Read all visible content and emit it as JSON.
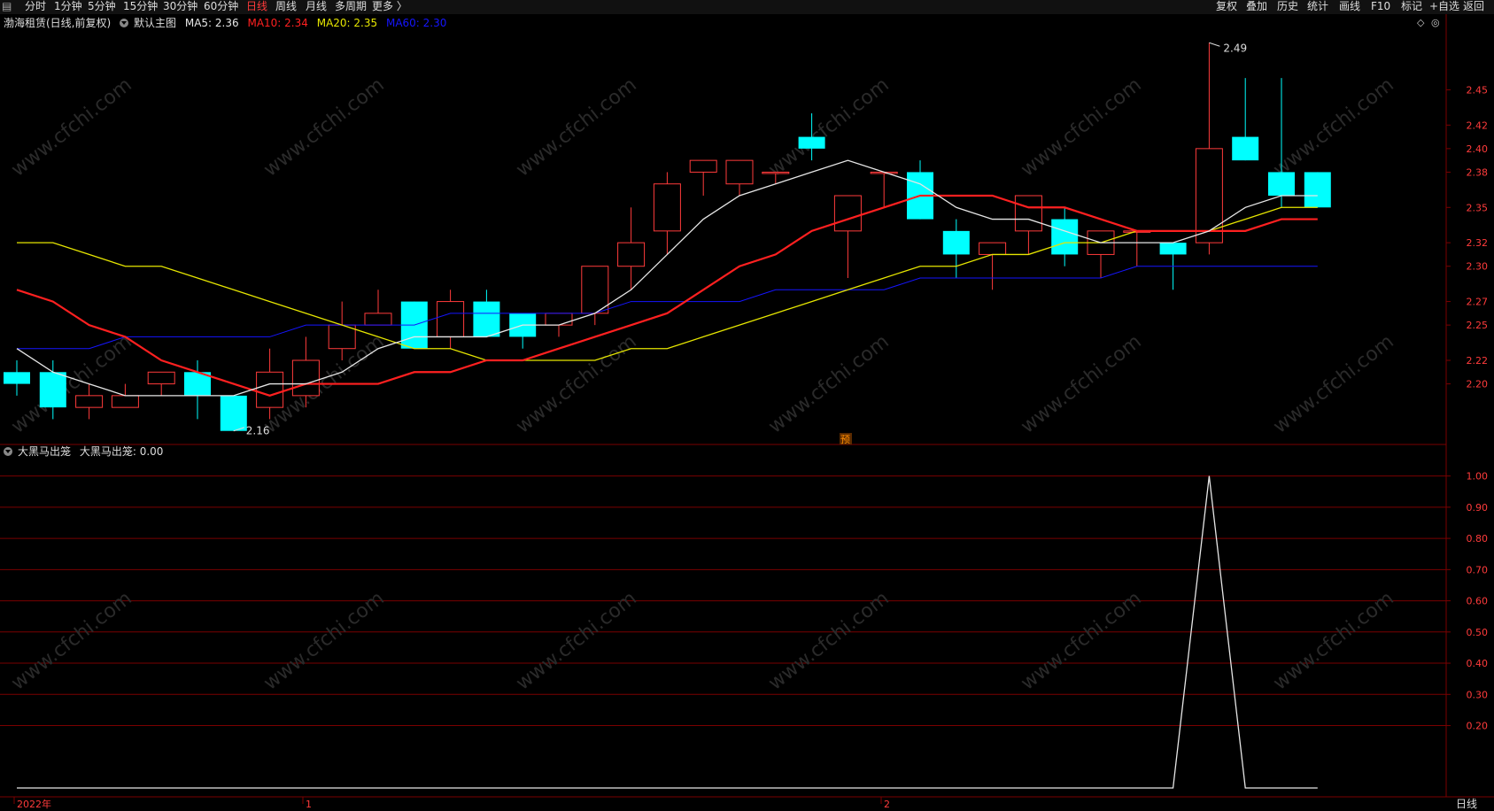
{
  "toolbar": {
    "left_items": [
      "分时",
      "1分钟",
      "5分钟",
      "15分钟",
      "30分钟",
      "60分钟",
      "日线",
      "周线",
      "月线",
      "多周期",
      "更多 〉"
    ],
    "active_item": "日线",
    "right_items": [
      "复权",
      "叠加",
      "历史",
      "统计",
      "画线",
      "F10",
      "标记",
      "+自选",
      "返回"
    ]
  },
  "main_header": {
    "stock_name": "渤海租赁(日线,前复权)",
    "chart_name": "默认主图",
    "ma5": "MA5: 2.36",
    "ma10": "MA10: 2.34",
    "ma20": "MA20: 2.35",
    "ma60": "MA60: 2.30"
  },
  "sub_header": {
    "indicator": "大黑马出笼",
    "value_text": "大黑马出笼: 0.00"
  },
  "colors": {
    "up": "#ff3b3b",
    "down": "#00ffff",
    "ma5": "#e6e6e6",
    "ma10": "#ff2020",
    "ma20": "#e6e600",
    "ma60": "#1515ff",
    "grid": "#7a0000",
    "axis_text": "#ff3b3b"
  },
  "annotations": {
    "high_label": "2.49",
    "low_label": "2.16",
    "marker": "预"
  },
  "x_axis": {
    "labels": [
      "2022年",
      "1",
      "2"
    ],
    "period_label": "日线"
  },
  "watermark": "www.cfchi.com",
  "chart_data": [
    {
      "type": "candlestick",
      "y_ticks": [
        2.2,
        2.22,
        2.25,
        2.27,
        2.3,
        2.32,
        2.35,
        2.38,
        2.4,
        2.42,
        2.45
      ],
      "ylim": [
        2.15,
        2.5
      ],
      "candles": [
        {
          "o": 2.21,
          "c": 2.2,
          "h": 2.22,
          "l": 2.19
        },
        {
          "o": 2.21,
          "c": 2.18,
          "h": 2.22,
          "l": 2.17
        },
        {
          "o": 2.18,
          "c": 2.19,
          "h": 2.2,
          "l": 2.17
        },
        {
          "o": 2.18,
          "c": 2.19,
          "h": 2.2,
          "l": 2.18
        },
        {
          "o": 2.2,
          "c": 2.21,
          "h": 2.21,
          "l": 2.19
        },
        {
          "o": 2.21,
          "c": 2.19,
          "h": 2.22,
          "l": 2.17
        },
        {
          "o": 2.19,
          "c": 2.16,
          "h": 2.19,
          "l": 2.16
        },
        {
          "o": 2.18,
          "c": 2.21,
          "h": 2.23,
          "l": 2.17
        },
        {
          "o": 2.19,
          "c": 2.22,
          "h": 2.24,
          "l": 2.18
        },
        {
          "o": 2.23,
          "c": 2.25,
          "h": 2.27,
          "l": 2.22
        },
        {
          "o": 2.25,
          "c": 2.26,
          "h": 2.28,
          "l": 2.25
        },
        {
          "o": 2.27,
          "c": 2.23,
          "h": 2.27,
          "l": 2.23
        },
        {
          "o": 2.24,
          "c": 2.27,
          "h": 2.28,
          "l": 2.23
        },
        {
          "o": 2.27,
          "c": 2.24,
          "h": 2.28,
          "l": 2.24
        },
        {
          "o": 2.26,
          "c": 2.24,
          "h": 2.26,
          "l": 2.23
        },
        {
          "o": 2.25,
          "c": 2.26,
          "h": 2.26,
          "l": 2.24
        },
        {
          "o": 2.26,
          "c": 2.3,
          "h": 2.3,
          "l": 2.25
        },
        {
          "o": 2.3,
          "c": 2.32,
          "h": 2.35,
          "l": 2.28
        },
        {
          "o": 2.33,
          "c": 2.37,
          "h": 2.38,
          "l": 2.31
        },
        {
          "o": 2.38,
          "c": 2.39,
          "h": 2.39,
          "l": 2.36
        },
        {
          "o": 2.37,
          "c": 2.39,
          "h": 2.39,
          "l": 2.36
        },
        {
          "o": 2.38,
          "c": 2.38,
          "h": 2.38,
          "l": 2.37
        },
        {
          "o": 2.41,
          "c": 2.4,
          "h": 2.43,
          "l": 2.39
        },
        {
          "o": 2.33,
          "c": 2.36,
          "h": 2.36,
          "l": 2.29
        },
        {
          "o": 2.38,
          "c": 2.38,
          "h": 2.38,
          "l": 2.35
        },
        {
          "o": 2.38,
          "c": 2.34,
          "h": 2.39,
          "l": 2.34
        },
        {
          "o": 2.33,
          "c": 2.31,
          "h": 2.34,
          "l": 2.29
        },
        {
          "o": 2.31,
          "c": 2.32,
          "h": 2.32,
          "l": 2.28
        },
        {
          "o": 2.33,
          "c": 2.36,
          "h": 2.36,
          "l": 2.31
        },
        {
          "o": 2.34,
          "c": 2.31,
          "h": 2.35,
          "l": 2.3
        },
        {
          "o": 2.31,
          "c": 2.33,
          "h": 2.33,
          "l": 2.29
        },
        {
          "o": 2.33,
          "c": 2.33,
          "h": 2.33,
          "l": 2.3
        },
        {
          "o": 2.32,
          "c": 2.31,
          "h": 2.32,
          "l": 2.28
        },
        {
          "o": 2.32,
          "c": 2.4,
          "h": 2.49,
          "l": 2.31
        },
        {
          "o": 2.41,
          "c": 2.39,
          "h": 2.46,
          "l": 2.39
        },
        {
          "o": 2.38,
          "c": 2.36,
          "h": 2.46,
          "l": 2.35
        },
        {
          "o": 2.38,
          "c": 2.35,
          "h": 2.38,
          "l": 2.35
        }
      ],
      "ma5": [
        2.23,
        2.21,
        2.2,
        2.19,
        2.19,
        2.19,
        2.19,
        2.2,
        2.2,
        2.21,
        2.23,
        2.24,
        2.24,
        2.24,
        2.25,
        2.25,
        2.26,
        2.28,
        2.31,
        2.34,
        2.36,
        2.37,
        2.38,
        2.39,
        2.38,
        2.37,
        2.35,
        2.34,
        2.34,
        2.33,
        2.32,
        2.32,
        2.32,
        2.33,
        2.35,
        2.36,
        2.36
      ],
      "ma10": [
        2.28,
        2.27,
        2.25,
        2.24,
        2.22,
        2.21,
        2.2,
        2.19,
        2.2,
        2.2,
        2.2,
        2.21,
        2.21,
        2.22,
        2.22,
        2.23,
        2.24,
        2.25,
        2.26,
        2.28,
        2.3,
        2.31,
        2.33,
        2.34,
        2.35,
        2.36,
        2.36,
        2.36,
        2.35,
        2.35,
        2.34,
        2.33,
        2.33,
        2.33,
        2.33,
        2.34,
        2.34
      ],
      "ma20": [
        2.32,
        2.32,
        2.31,
        2.3,
        2.3,
        2.29,
        2.28,
        2.27,
        2.26,
        2.25,
        2.24,
        2.23,
        2.23,
        2.22,
        2.22,
        2.22,
        2.22,
        2.23,
        2.23,
        2.24,
        2.25,
        2.26,
        2.27,
        2.28,
        2.29,
        2.3,
        2.3,
        2.31,
        2.31,
        2.32,
        2.32,
        2.33,
        2.33,
        2.33,
        2.34,
        2.35,
        2.35
      ],
      "ma60": [
        2.23,
        2.23,
        2.23,
        2.24,
        2.24,
        2.24,
        2.24,
        2.24,
        2.25,
        2.25,
        2.25,
        2.25,
        2.26,
        2.26,
        2.26,
        2.26,
        2.26,
        2.27,
        2.27,
        2.27,
        2.27,
        2.28,
        2.28,
        2.28,
        2.28,
        2.29,
        2.29,
        2.29,
        2.29,
        2.29,
        2.29,
        2.3,
        2.3,
        2.3,
        2.3,
        2.3,
        2.3
      ]
    },
    {
      "type": "line",
      "y_ticks": [
        0.2,
        0.3,
        0.4,
        0.5,
        0.6,
        0.7,
        0.8,
        0.9,
        1.0
      ],
      "ylim": [
        0,
        1.05
      ],
      "series": [
        {
          "name": "大黑马出笼",
          "values": [
            0,
            0,
            0,
            0,
            0,
            0,
            0,
            0,
            0,
            0,
            0,
            0,
            0,
            0,
            0,
            0,
            0,
            0,
            0,
            0,
            0,
            0,
            0,
            0,
            0,
            0,
            0,
            0,
            0,
            0,
            0,
            0,
            0,
            1,
            0,
            0,
            0
          ]
        }
      ]
    }
  ]
}
